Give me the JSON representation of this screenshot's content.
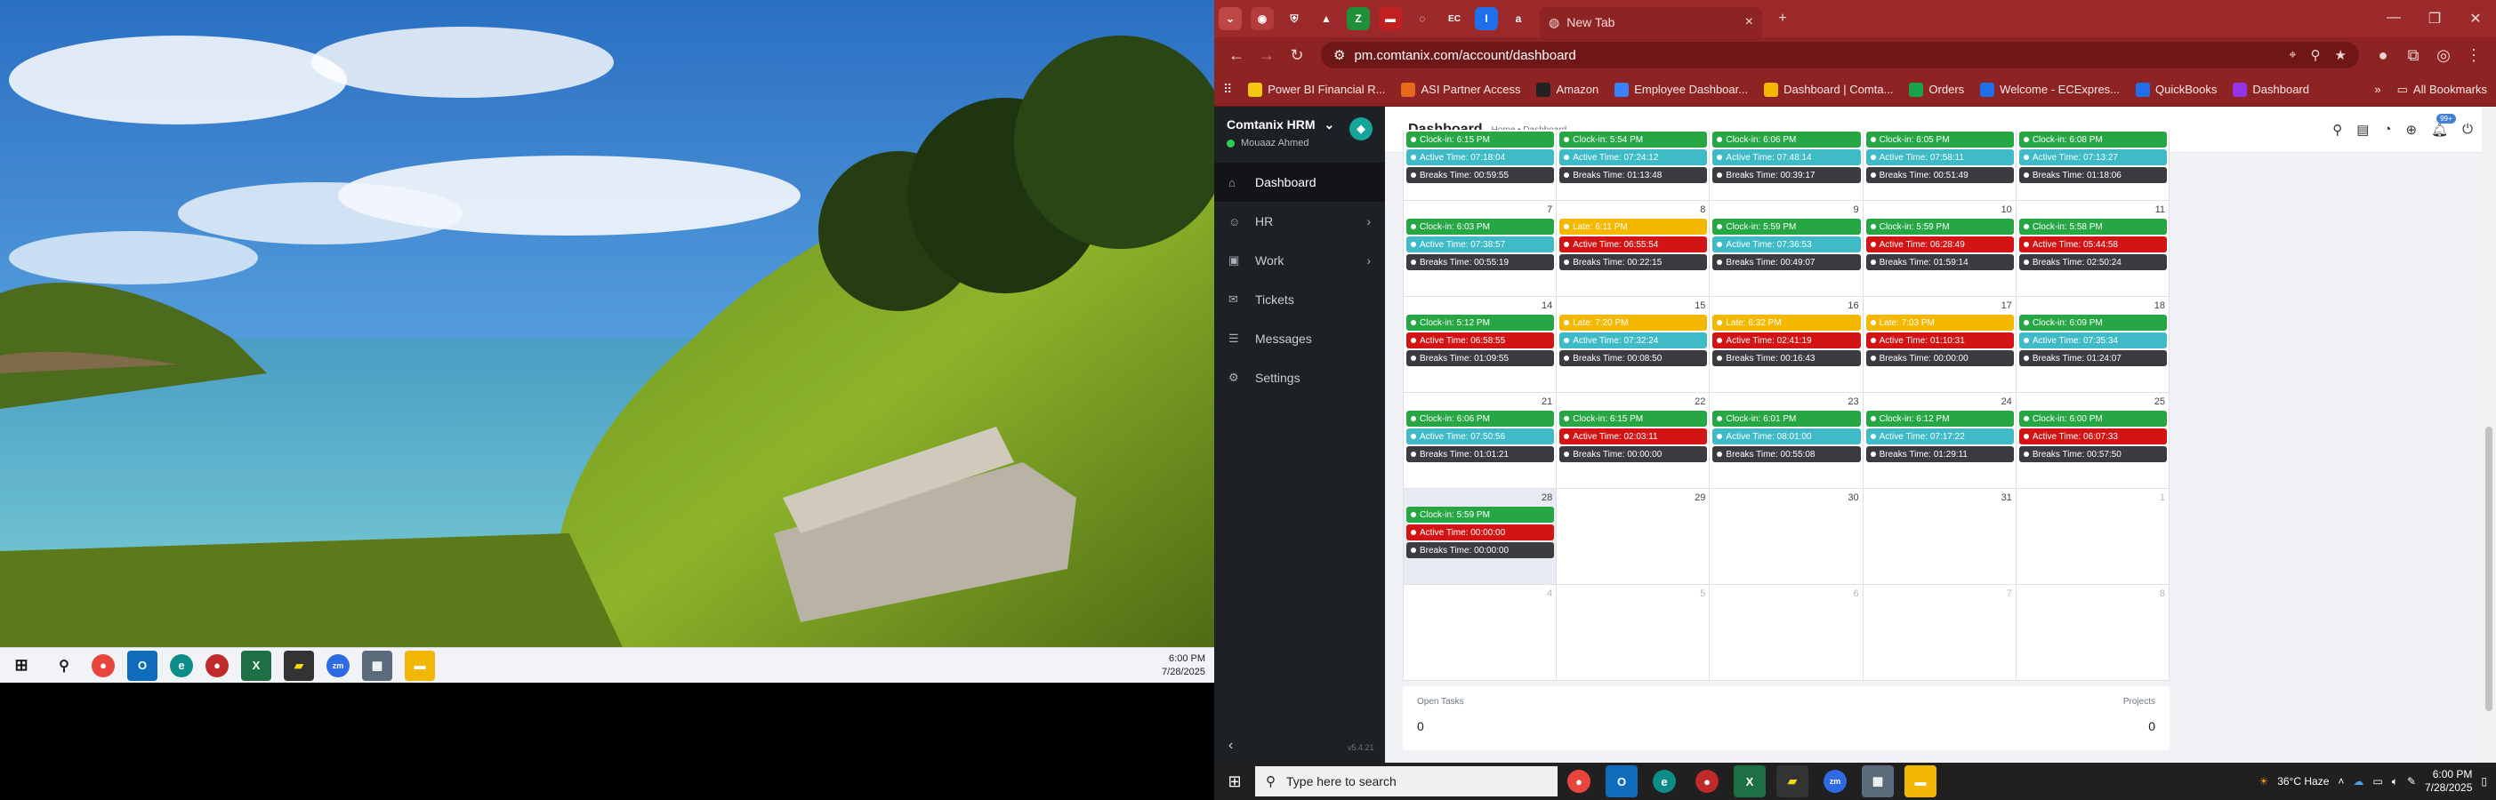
{
  "left_taskbar": {
    "time": "6:00 PM",
    "date": "7/28/2025"
  },
  "chrome": {
    "active_tab_title": "New Tab",
    "url": "pm.comtanix.com/account/dashboard",
    "bookmarks": [
      {
        "label": "Power BI Financial R...",
        "color": "#f2c811"
      },
      {
        "label": "ASI Partner Access",
        "color": "#e86a1c"
      },
      {
        "label": "Amazon",
        "color": "#222222"
      },
      {
        "label": "Employee Dashboar...",
        "color": "#3b82f6"
      },
      {
        "label": "Dashboard | Comta...",
        "color": "#f5b800"
      },
      {
        "label": "Orders",
        "color": "#16a34a"
      },
      {
        "label": "Welcome - ECExpres...",
        "color": "#1f6feb"
      },
      {
        "label": "QuickBooks",
        "color": "#1f6feb"
      },
      {
        "label": "Dashboard",
        "color": "#9333ea"
      }
    ],
    "all_bookmarks_label": "All Bookmarks"
  },
  "app": {
    "brand": "Comtanix HRM",
    "user": "Mouaaz Ahmed",
    "nav": [
      {
        "label": "Dashboard",
        "icon": "home-icon",
        "active": true,
        "has_children": false
      },
      {
        "label": "HR",
        "icon": "users-icon",
        "active": false,
        "has_children": true
      },
      {
        "label": "Work",
        "icon": "briefcase-icon",
        "active": false,
        "has_children": true
      },
      {
        "label": "Tickets",
        "icon": "ticket-icon",
        "active": false,
        "has_children": false
      },
      {
        "label": "Messages",
        "icon": "chat-icon",
        "active": false,
        "has_children": false
      },
      {
        "label": "Settings",
        "icon": "gear-icon",
        "active": false,
        "has_children": false
      }
    ],
    "version": "v5.4.21",
    "page_title": "Dashboard",
    "breadcrumb": "Home • Dashboard",
    "notification_count": "99+"
  },
  "calendar": {
    "weeks": [
      [
        {
          "day": "",
          "events": [
            [
              "green",
              "Clock-in: 6:15 PM"
            ],
            [
              "teal",
              "Active Time: 07:18:04"
            ],
            [
              "dark",
              "Breaks Time: 00:59:55"
            ]
          ]
        },
        {
          "day": "",
          "events": [
            [
              "green",
              "Clock-in: 5:54 PM"
            ],
            [
              "teal",
              "Active Time: 07:24:12"
            ],
            [
              "dark",
              "Breaks Time: 01:13:48"
            ]
          ]
        },
        {
          "day": "",
          "events": [
            [
              "green",
              "Clock-in: 6:06 PM"
            ],
            [
              "teal",
              "Active Time: 07:48:14"
            ],
            [
              "dark",
              "Breaks Time: 00:39:17"
            ]
          ]
        },
        {
          "day": "",
          "events": [
            [
              "green",
              "Clock-in: 6:05 PM"
            ],
            [
              "teal",
              "Active Time: 07:58:11"
            ],
            [
              "dark",
              "Breaks Time: 00:51:49"
            ]
          ]
        },
        {
          "day": "",
          "events": [
            [
              "green",
              "Clock-in: 6:08 PM"
            ],
            [
              "teal",
              "Active Time: 07:13:27"
            ],
            [
              "dark",
              "Breaks Time: 01:18:06"
            ]
          ]
        }
      ],
      [
        {
          "day": "7",
          "events": [
            [
              "green",
              "Clock-in: 6:03 PM"
            ],
            [
              "teal",
              "Active Time: 07:38:57"
            ],
            [
              "dark",
              "Breaks Time: 00:55:19"
            ]
          ]
        },
        {
          "day": "8",
          "events": [
            [
              "yellow",
              "Late: 6:11 PM"
            ],
            [
              "red",
              "Active Time: 06:55:54"
            ],
            [
              "dark",
              "Breaks Time: 00:22:15"
            ]
          ]
        },
        {
          "day": "9",
          "events": [
            [
              "green",
              "Clock-in: 5:59 PM"
            ],
            [
              "teal",
              "Active Time: 07:36:53"
            ],
            [
              "dark",
              "Breaks Time: 00:49:07"
            ]
          ]
        },
        {
          "day": "10",
          "events": [
            [
              "green",
              "Clock-in: 5:59 PM"
            ],
            [
              "red",
              "Active Time: 06:28:49"
            ],
            [
              "dark",
              "Breaks Time: 01:59:14"
            ]
          ]
        },
        {
          "day": "11",
          "events": [
            [
              "green",
              "Clock-in: 5:58 PM"
            ],
            [
              "red",
              "Active Time: 05:44:58"
            ],
            [
              "dark",
              "Breaks Time: 02:50:24"
            ]
          ]
        }
      ],
      [
        {
          "day": "14",
          "events": [
            [
              "green",
              "Clock-in: 5:12 PM"
            ],
            [
              "red",
              "Active Time: 06:58:55"
            ],
            [
              "dark",
              "Breaks Time: 01:09:55"
            ]
          ]
        },
        {
          "day": "15",
          "events": [
            [
              "yellow",
              "Late: 7:20 PM"
            ],
            [
              "teal",
              "Active Time: 07:32:24"
            ],
            [
              "dark",
              "Breaks Time: 00:08:50"
            ]
          ]
        },
        {
          "day": "16",
          "events": [
            [
              "yellow",
              "Late: 6:32 PM"
            ],
            [
              "red",
              "Active Time: 02:41:19"
            ],
            [
              "dark",
              "Breaks Time: 00:16:43"
            ]
          ]
        },
        {
          "day": "17",
          "events": [
            [
              "yellow",
              "Late: 7:03 PM"
            ],
            [
              "red",
              "Active Time: 01:10:31"
            ],
            [
              "dark",
              "Breaks Time: 00:00:00"
            ]
          ]
        },
        {
          "day": "18",
          "events": [
            [
              "green",
              "Clock-in: 6:09 PM"
            ],
            [
              "teal",
              "Active Time: 07:35:34"
            ],
            [
              "dark",
              "Breaks Time: 01:24:07"
            ]
          ]
        }
      ],
      [
        {
          "day": "21",
          "events": [
            [
              "green",
              "Clock-in: 6:06 PM"
            ],
            [
              "teal",
              "Active Time: 07:50:56"
            ],
            [
              "dark",
              "Breaks Time: 01:01:21"
            ]
          ]
        },
        {
          "day": "22",
          "events": [
            [
              "green",
              "Clock-in: 6:15 PM"
            ],
            [
              "red",
              "Active Time: 02:03:11"
            ],
            [
              "dark",
              "Breaks Time: 00:00:00"
            ]
          ]
        },
        {
          "day": "23",
          "events": [
            [
              "green",
              "Clock-in: 6:01 PM"
            ],
            [
              "teal",
              "Active Time: 08:01:00"
            ],
            [
              "dark",
              "Breaks Time: 00:55:08"
            ]
          ]
        },
        {
          "day": "24",
          "events": [
            [
              "green",
              "Clock-in: 6:12 PM"
            ],
            [
              "teal",
              "Active Time: 07:17:22"
            ],
            [
              "dark",
              "Breaks Time: 01:29:11"
            ]
          ]
        },
        {
          "day": "25",
          "events": [
            [
              "green",
              "Clock-in: 6:00 PM"
            ],
            [
              "red",
              "Active Time: 06:07:33"
            ],
            [
              "dark",
              "Breaks Time: 00:57:50"
            ]
          ]
        }
      ],
      [
        {
          "day": "28",
          "today": true,
          "events": [
            [
              "green",
              "Clock-in: 5:59 PM"
            ],
            [
              "red",
              "Active Time: 00:00:00"
            ],
            [
              "dark",
              "Breaks Time: 00:00:00"
            ]
          ]
        },
        {
          "day": "29",
          "events": []
        },
        {
          "day": "30",
          "events": []
        },
        {
          "day": "31",
          "events": []
        },
        {
          "day": "1",
          "muted": true,
          "events": []
        }
      ],
      [
        {
          "day": "4",
          "muted": true,
          "events": []
        },
        {
          "day": "5",
          "muted": true,
          "events": []
        },
        {
          "day": "6",
          "muted": true,
          "events": []
        },
        {
          "day": "7",
          "muted": true,
          "events": []
        },
        {
          "day": "8",
          "muted": true,
          "events": []
        }
      ]
    ],
    "colors": {
      "green": "#27a744",
      "teal": "#3fbac7",
      "red": "#d21414",
      "dark": "#3a3c40",
      "yellow": "#f5b800"
    }
  },
  "stats": {
    "open_tasks_label": "Open Tasks",
    "open_tasks_value": "0",
    "projects_label": "Projects",
    "projects_value": "0"
  },
  "right_taskbar": {
    "search_placeholder": "Type here to search",
    "weather": "36°C  Haze",
    "time": "6:00 PM",
    "date": "7/28/2025"
  }
}
